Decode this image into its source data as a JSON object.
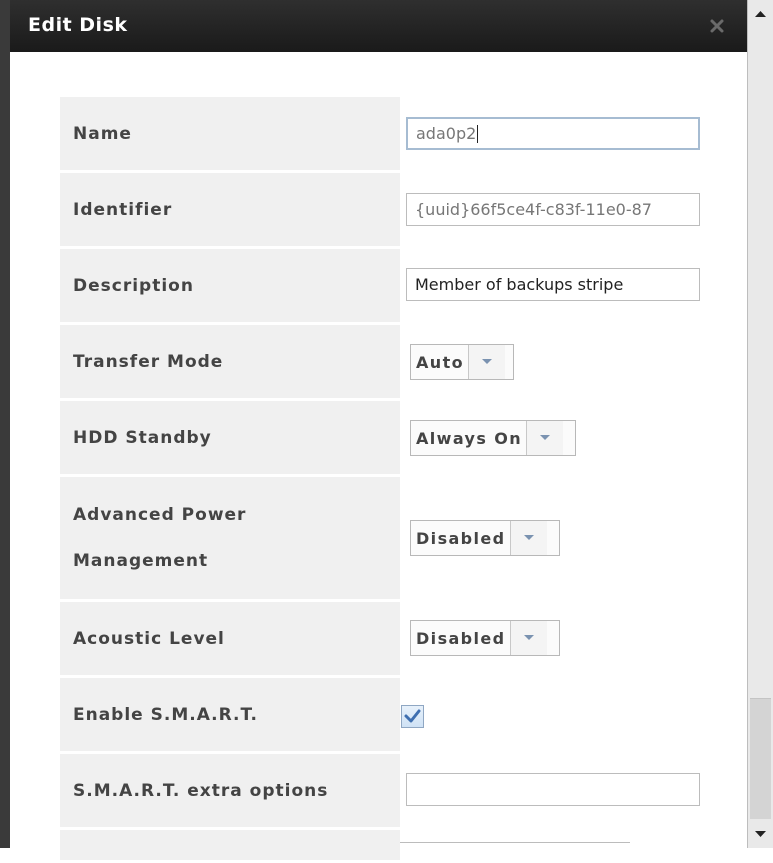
{
  "dialog": {
    "title": "Edit Disk",
    "colors": {
      "titlebar": "#1f1f1f",
      "label_bg": "#f0f0f0",
      "label_text": "#444444",
      "focus_border": "#a6bcd2"
    },
    "icons": {
      "close": "close-x-icon",
      "dropdown": "chevron-down-icon",
      "check": "checkmark-icon"
    }
  },
  "form": {
    "name": {
      "label": "Name",
      "value": "ada0p2"
    },
    "identifier": {
      "label": "Identifier",
      "value": "{uuid}66f5ce4f-c83f-11e0-87"
    },
    "description": {
      "label": "Description",
      "value": "Member of backups stripe"
    },
    "transfer_mode": {
      "label": "Transfer Mode",
      "value": "Auto"
    },
    "hdd_standby": {
      "label": "HDD Standby",
      "value": "Always On"
    },
    "apm": {
      "label_line1": "Advanced Power",
      "label_line2": "Management",
      "value": "Disabled"
    },
    "acoustic_level": {
      "label": "Acoustic Level",
      "value": "Disabled"
    },
    "enable_smart": {
      "label": "Enable S.M.A.R.T.",
      "checked": true
    },
    "smart_extra_options": {
      "label": "S.M.A.R.T. extra options",
      "value": ""
    }
  }
}
